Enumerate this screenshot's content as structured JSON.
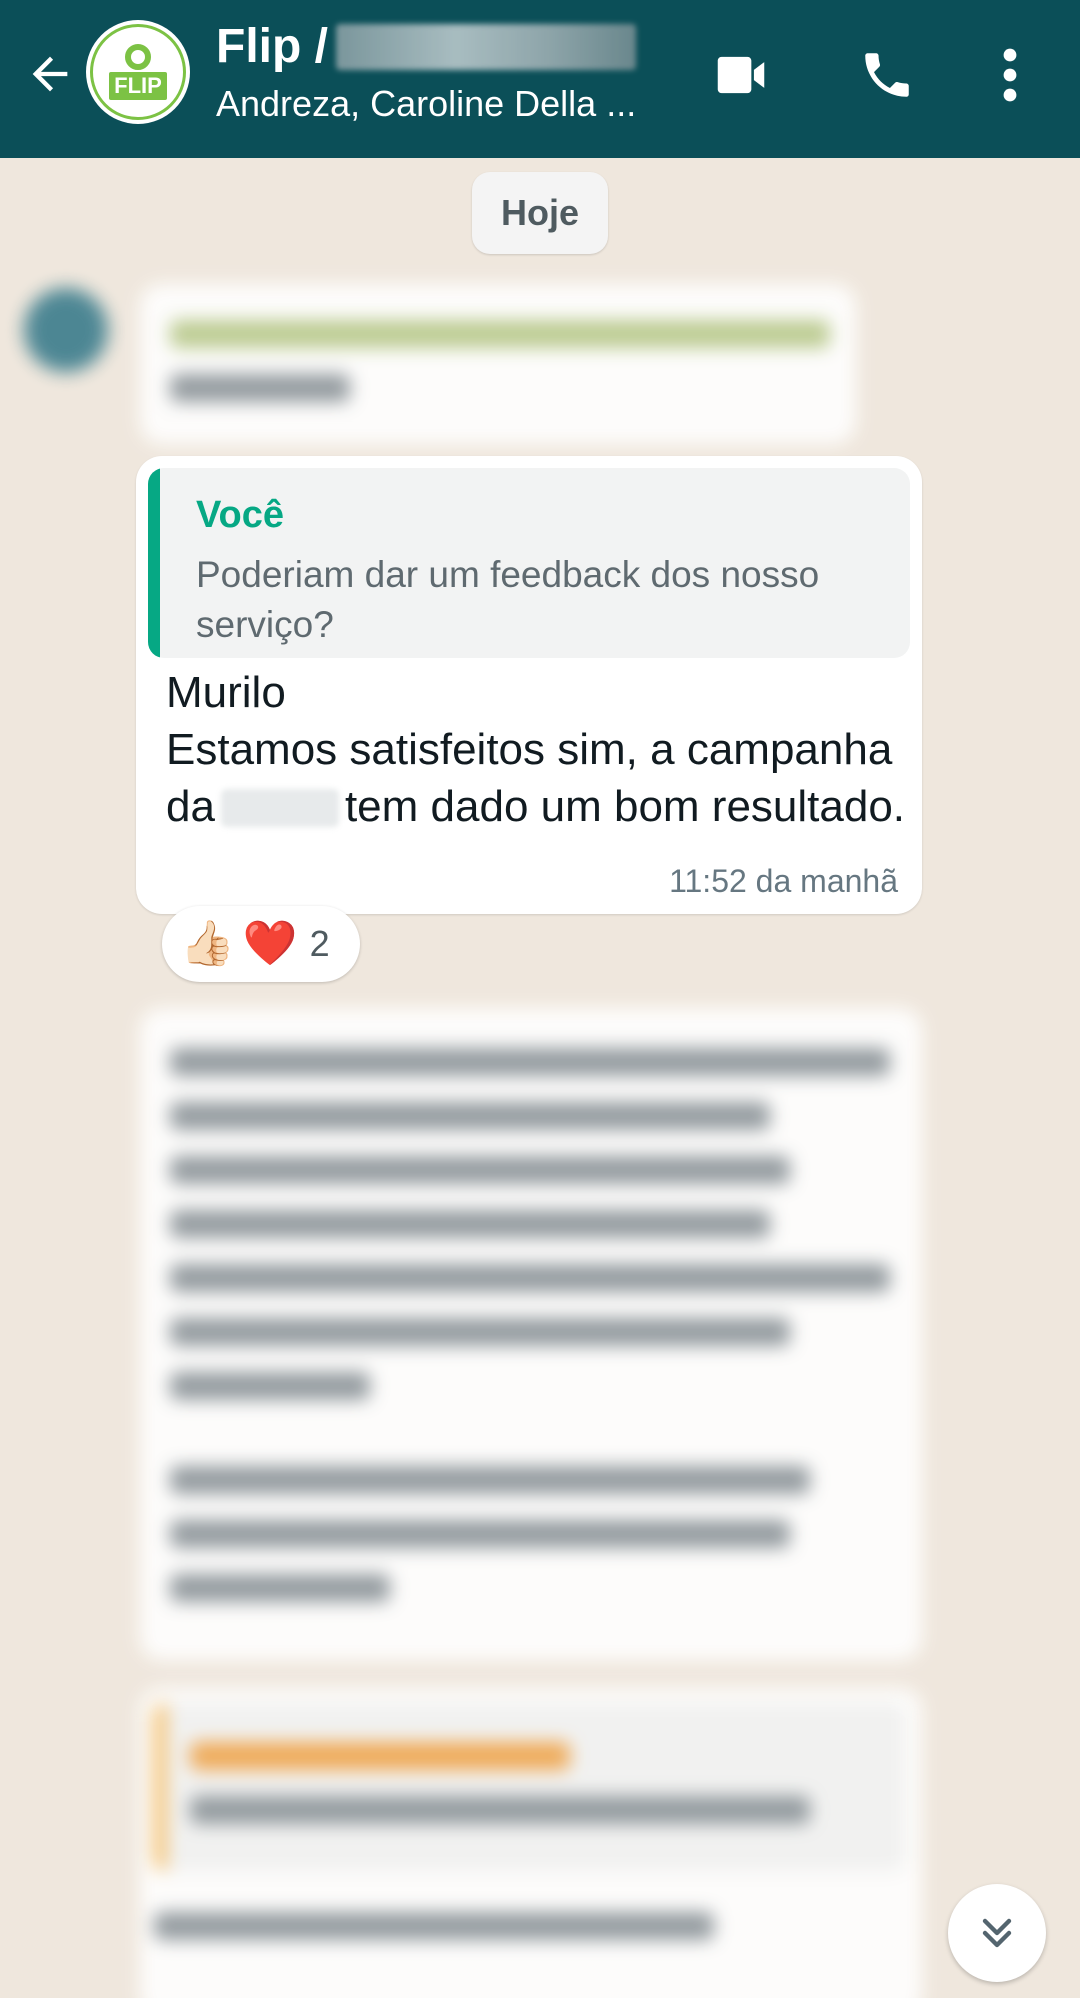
{
  "header": {
    "title": "Flip /",
    "subtitle": "Andreza, Caroline Della ...",
    "avatar_text": "FLIP",
    "icons": {
      "back": "back-arrow-icon",
      "video": "video-call-icon",
      "phone": "phone-call-icon",
      "menu": "more-vertical-icon"
    }
  },
  "date_separator": "Hoje",
  "message": {
    "quote": {
      "author": "Você",
      "text": "Poderiam dar um feedback dos nosso serviço?"
    },
    "line1": "Murilo",
    "line2_part1": "Estamos satisfeitos sim, a campanha da",
    "line2_part2": "tem dado um bom resultado.",
    "time": "11:52 da manhã"
  },
  "reactions": {
    "emojis": [
      "👍🏻",
      "❤️"
    ],
    "count": "2"
  },
  "colors": {
    "header": "#0b4f58",
    "accent_green": "#06a884",
    "chat_background": "#efe7dd"
  },
  "scroll_button_icon": "double-chevron-down-icon"
}
